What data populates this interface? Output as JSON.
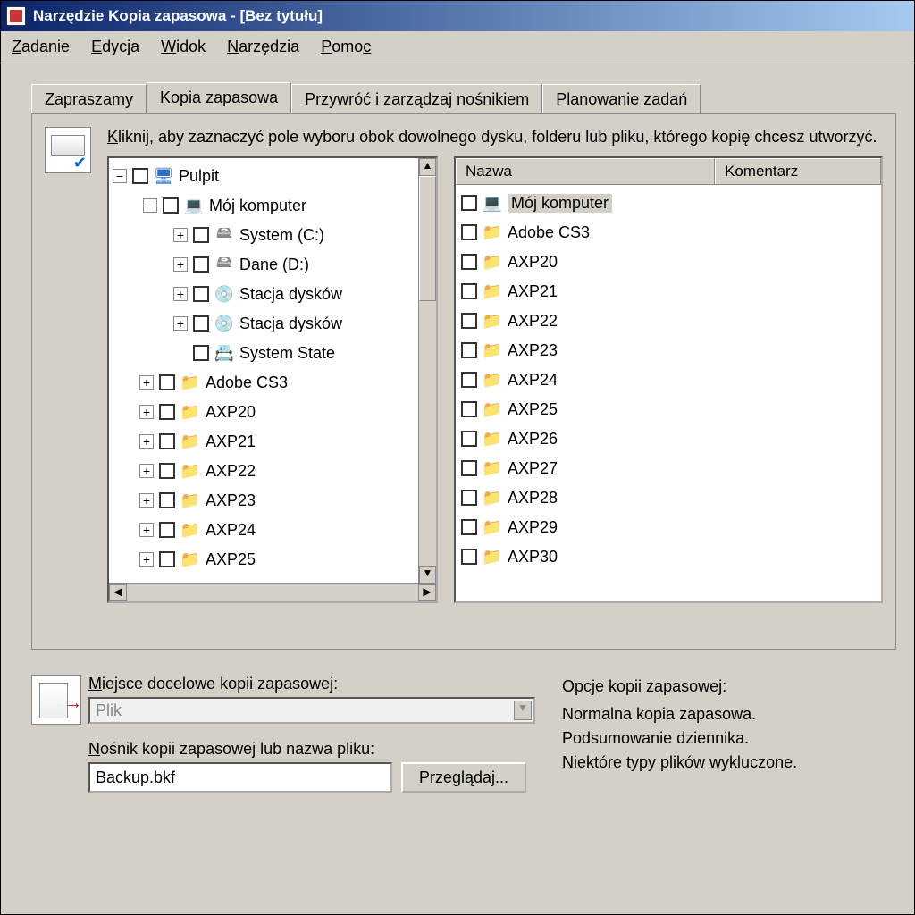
{
  "window": {
    "title": "Narzędzie Kopia zapasowa - [Bez tytułu]"
  },
  "menubar": [
    {
      "label": "Zadanie",
      "mn": "Z"
    },
    {
      "label": "Edycja",
      "mn": "E"
    },
    {
      "label": "Widok",
      "mn": "W"
    },
    {
      "label": "Narzędzia",
      "mn": "N"
    },
    {
      "label": "Pomoc",
      "mn": "P"
    }
  ],
  "tabs": {
    "zapraszamy": "Zapraszamy",
    "kopia": "Kopia zapasowa",
    "przywroc": "Przywróć i zarządzaj nośnikiem",
    "planowanie": "Planowanie zadań"
  },
  "instruction": "Kliknij, aby zaznaczyć pole wyboru obok dowolnego dysku, folderu lub pliku, którego kopię chcesz utworzyć.",
  "tree": {
    "pulpit": "Pulpit",
    "moj_komputer": "Mój komputer",
    "system_c": "System (C:)",
    "dane_d": "Dane (D:)",
    "stacja1": "Stacja dysków",
    "stacja2": "Stacja dysków",
    "system_state": "System State",
    "adobe": "Adobe CS3",
    "axp20": "AXP20",
    "axp21": "AXP21",
    "axp22": "AXP22",
    "axp23": "AXP23",
    "axp24": "AXP24",
    "axp25": "AXP25"
  },
  "list": {
    "col_nazwa": "Nazwa",
    "col_komentarz": "Komentarz",
    "items": [
      {
        "label": "Mój komputer",
        "type": "computer",
        "selected": true
      },
      {
        "label": "Adobe CS3",
        "type": "folder"
      },
      {
        "label": "AXP20",
        "type": "folder"
      },
      {
        "label": "AXP21",
        "type": "folder"
      },
      {
        "label": "AXP22",
        "type": "folder"
      },
      {
        "label": "AXP23",
        "type": "folder"
      },
      {
        "label": "AXP24",
        "type": "folder"
      },
      {
        "label": "AXP25",
        "type": "folder"
      },
      {
        "label": "AXP26",
        "type": "folder"
      },
      {
        "label": "AXP27",
        "type": "folder"
      },
      {
        "label": "AXP28",
        "type": "folder"
      },
      {
        "label": "AXP29",
        "type": "folder"
      },
      {
        "label": "AXP30",
        "type": "folder"
      }
    ]
  },
  "dest": {
    "label": "Miejsce docelowe kopii zapasowej:",
    "value": "Plik",
    "media_label": "Nośnik kopii zapasowej lub nazwa pliku:",
    "media_value": "Backup.bkf",
    "browse": "Przeglądaj..."
  },
  "options": {
    "header": "Opcje kopii zapasowej:",
    "line1": "Normalna kopia zapasowa.",
    "line2": "Podsumowanie dziennika.",
    "line3": "Niektóre typy plików wykluczone."
  }
}
